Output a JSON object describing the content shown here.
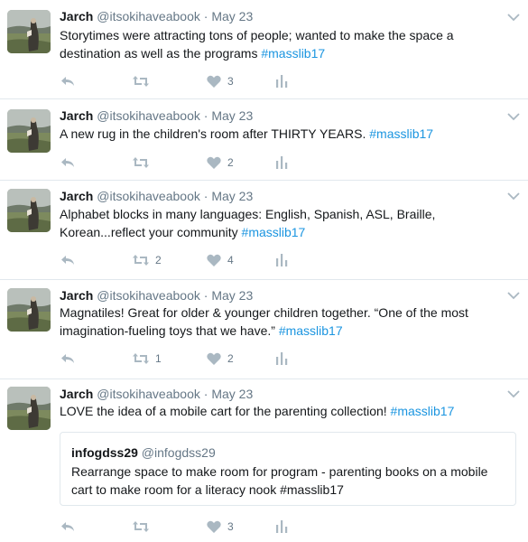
{
  "colors": {
    "link": "#1b95e0",
    "muted": "#657786",
    "border": "#e1e8ed",
    "text": "#14171a"
  },
  "icons": {
    "reply": "reply-icon",
    "retweet": "retweet-icon",
    "like": "heart-icon",
    "analytics": "analytics-icon",
    "more": "chevron-down-icon"
  },
  "tweets": [
    {
      "name": "Jarch",
      "handle": "@itsokihaveabook",
      "dot": "·",
      "date": "May 23",
      "text": "Storytimes were attracting tons of people; wanted to make the space a destination as well as the programs",
      "hashtag": "#masslib17",
      "retweets": "",
      "likes": "3"
    },
    {
      "name": "Jarch",
      "handle": "@itsokihaveabook",
      "dot": "·",
      "date": "May 23",
      "text": "A new rug in the children's room after THIRTY YEARS.",
      "hashtag": "#masslib17",
      "retweets": "",
      "likes": "2"
    },
    {
      "name": "Jarch",
      "handle": "@itsokihaveabook",
      "dot": "·",
      "date": "May 23",
      "text": "Alphabet blocks in many languages: English, Spanish, ASL, Braille, Korean...reflect your community",
      "hashtag": "#masslib17",
      "retweets": "2",
      "likes": "4"
    },
    {
      "name": "Jarch",
      "handle": "@itsokihaveabook",
      "dot": "·",
      "date": "May 23",
      "text": "Magnatiles! Great for older & younger children together. “One of the most imagination-fueling toys that we have.”",
      "hashtag": "#masslib17",
      "retweets": "1",
      "likes": "2"
    },
    {
      "name": "Jarch",
      "handle": "@itsokihaveabook",
      "dot": "·",
      "date": "May 23",
      "text": "LOVE the idea of a mobile cart for the parenting collection!",
      "hashtag": "#masslib17",
      "retweets": "",
      "likes": "3",
      "quote": {
        "name": "infogdss29",
        "handle": "@infogdss29",
        "text": "Rearrange space to make room for program - parenting books on a mobile cart to make room for a literacy nook #masslib17"
      }
    }
  ]
}
